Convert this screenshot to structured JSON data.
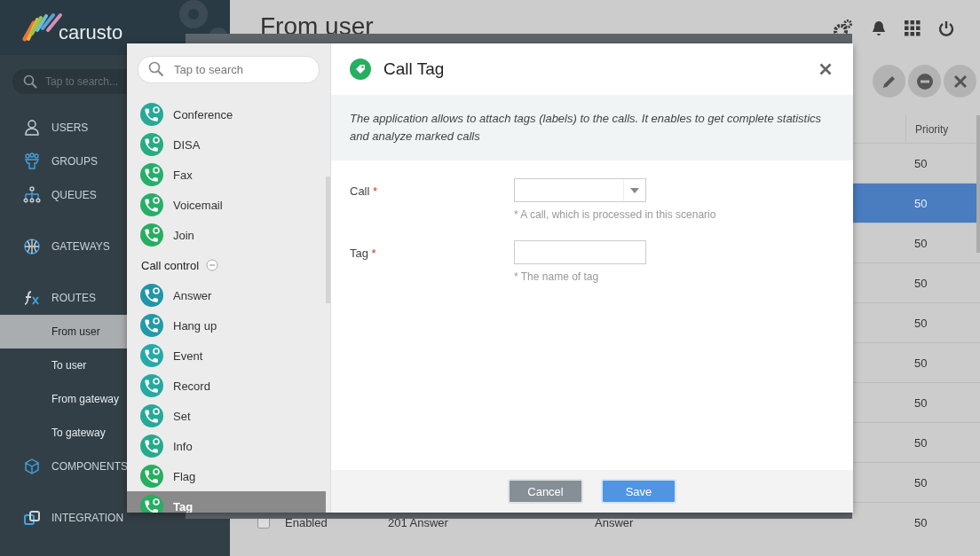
{
  "sidebar": {
    "logo": "carusto",
    "search": {
      "placeholder": "Tap to search..."
    },
    "groups": [
      [
        {
          "label": "USERS",
          "selected": false
        },
        {
          "label": "GROUPS",
          "selected": false
        },
        {
          "label": "QUEUES",
          "selected": false
        }
      ],
      [
        {
          "label": "GATEWAYS",
          "selected": false
        }
      ],
      [
        {
          "label": "ROUTES",
          "selected": false,
          "expanded": true,
          "children": [
            {
              "label": "From user",
              "selected": true
            },
            {
              "label": "To user",
              "selected": false
            },
            {
              "label": "From gateway",
              "selected": false
            },
            {
              "label": "To gateway",
              "selected": false
            }
          ]
        },
        {
          "label": "COMPONENTS",
          "selected": false
        }
      ],
      [
        {
          "label": "INTEGRATION",
          "selected": false
        }
      ]
    ]
  },
  "page": {
    "title": "From user"
  },
  "table": {
    "columns": [
      "Priority"
    ],
    "rows": [
      {
        "selected": false,
        "priority": "50"
      },
      {
        "selected": true,
        "priority": "50"
      },
      {
        "selected": false,
        "priority": "50"
      },
      {
        "selected": false,
        "priority": "50"
      },
      {
        "selected": false,
        "priority": "50"
      },
      {
        "selected": false,
        "priority": "50"
      },
      {
        "selected": false,
        "priority": "50"
      },
      {
        "selected": false,
        "priority": "50"
      },
      {
        "selected": false,
        "priority": "50"
      },
      {
        "selected": false,
        "checked": false,
        "status": "Enabled",
        "name": "201 Answer",
        "column_4": "Answer",
        "priority": "50"
      }
    ]
  },
  "modal": {
    "search": {
      "placeholder": "Tap to search"
    },
    "list": [
      {
        "kind": "item",
        "label": "Conference",
        "color": "#26a996",
        "selected": false
      },
      {
        "kind": "item",
        "label": "DISA",
        "color": "#27ab82",
        "selected": false
      },
      {
        "kind": "item",
        "label": "Fax",
        "color": "#27ae6a",
        "selected": false
      },
      {
        "kind": "item",
        "label": "Voicemail",
        "color": "#27ae6a",
        "selected": false
      },
      {
        "kind": "item",
        "label": "Join",
        "color": "#27ae60",
        "selected": false
      },
      {
        "kind": "group",
        "label": "Call control",
        "expanded": true
      },
      {
        "kind": "item",
        "label": "Answer",
        "color": "#2196a8",
        "selected": false
      },
      {
        "kind": "item",
        "label": "Hang up",
        "color": "#239aa8",
        "selected": false
      },
      {
        "kind": "item",
        "label": "Event",
        "color": "#26aaa8",
        "selected": false
      },
      {
        "kind": "item",
        "label": "Record",
        "color": "#26a9a0",
        "selected": false
      },
      {
        "kind": "item",
        "label": "Set",
        "color": "#26a998",
        "selected": false
      },
      {
        "kind": "item",
        "label": "Info",
        "color": "#26aa8c",
        "selected": false
      },
      {
        "kind": "item",
        "label": "Flag",
        "color": "#27ae60",
        "selected": false
      },
      {
        "kind": "item",
        "label": "Tag",
        "color": "#27ae60",
        "selected": true
      }
    ],
    "title": "Call Tag",
    "description": "The application allows to attach tags (labels) to the calls. It enables to get complete statistics and analyze marked calls",
    "fields": [
      {
        "kind": "select",
        "label": "Call",
        "required_mark": "*",
        "hint": "* A call, which is processed in this scenario"
      },
      {
        "kind": "text",
        "label": "Tag",
        "required_mark": "*",
        "hint": "* The name of tag"
      }
    ],
    "buttons": [
      {
        "kind": "secondary",
        "label": "Cancel"
      },
      {
        "kind": "primary",
        "label": "Save"
      }
    ]
  }
}
